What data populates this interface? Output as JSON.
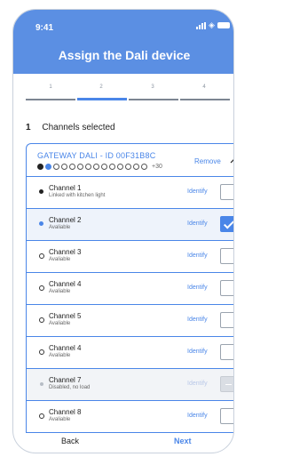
{
  "status_bar": {
    "time": "9:41"
  },
  "header": {
    "title": "Assign the Dali device"
  },
  "stepper": {
    "steps": [
      "1",
      "2",
      "3",
      "4"
    ],
    "active_step": "2"
  },
  "selection": {
    "count": "1",
    "label": "Channels selected"
  },
  "gateway": {
    "title": "GATEWAY DALI - ID 00F31B8C",
    "more_count": "+30",
    "remove_label": "Remove"
  },
  "channels": [
    {
      "name": "Channel 1",
      "sub": "Linked with kitchen light",
      "identify": "Identify",
      "state": "unchecked",
      "bullet": "black"
    },
    {
      "name": "Channel 2",
      "sub": "Avaliable",
      "identify": "Identify",
      "state": "checked",
      "bullet": "blue"
    },
    {
      "name": "Channel 3",
      "sub": "Avaliable",
      "identify": "Identify",
      "state": "unchecked",
      "bullet": "open"
    },
    {
      "name": "Channel 4",
      "sub": "Avaliable",
      "identify": "Identify",
      "state": "unchecked",
      "bullet": "open"
    },
    {
      "name": "Channel 5",
      "sub": "Avaliable",
      "identify": "Identify",
      "state": "unchecked",
      "bullet": "open"
    },
    {
      "name": "Channel 4",
      "sub": "Avaliable",
      "identify": "Identify",
      "state": "unchecked",
      "bullet": "open"
    },
    {
      "name": "Channel 7",
      "sub": "Disabled,  no load",
      "identify": "Identify",
      "state": "disabled",
      "bullet": "grey"
    },
    {
      "name": "Channel 8",
      "sub": "Avaliable",
      "identify": "Identify",
      "state": "unchecked",
      "bullet": "open"
    }
  ],
  "footer": {
    "back_label": "Back",
    "next_label": "Next"
  },
  "colors": {
    "accent": "#4a86e8",
    "header": "#5b8fe3"
  },
  "icons": {
    "signal": "signal-icon",
    "wifi": "wifi-icon",
    "battery": "battery-icon",
    "collapse": "chevron-up-icon",
    "check": "check-icon"
  }
}
